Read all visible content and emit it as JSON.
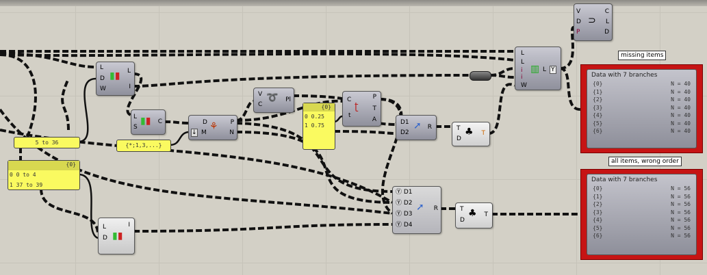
{
  "panels": {
    "range": "5 to 36",
    "pattern": "{*;1,3,...}",
    "list": {
      "path": "{0}",
      "rows": [
        {
          "i": "0",
          "v": "0 to 4"
        },
        {
          "i": "1",
          "v": "37 to 39"
        }
      ]
    },
    "params": {
      "path": "{0}",
      "rows": [
        {
          "i": "0",
          "v": "0.25"
        },
        {
          "i": "1",
          "v": "0.75"
        }
      ]
    }
  },
  "components": {
    "top_right": {
      "in": [
        "V",
        "D",
        "P"
      ],
      "out": [
        "C",
        "L",
        "D"
      ]
    },
    "weave": {
      "in": [
        "L",
        "L",
        "i",
        "i",
        "W"
      ],
      "out": [
        "L"
      ],
      "flag": "Y"
    },
    "dispatch_top": {
      "in": [
        "L",
        "D",
        "W"
      ],
      "out": [
        "L",
        "I"
      ]
    },
    "split": {
      "in": [
        "L",
        "S"
      ],
      "out": [
        "C"
      ]
    },
    "tree": {
      "in": [
        "D",
        "M"
      ],
      "out": [
        "P",
        "N"
      ]
    },
    "perp": {
      "in": [
        "V",
        "C"
      ],
      "out": [
        "Pl"
      ]
    },
    "eval": {
      "in": [
        "C",
        "t"
      ],
      "out": [
        "P",
        "T",
        "A"
      ]
    },
    "merge2": {
      "in": [
        "D1",
        "D2"
      ],
      "out": [
        "R"
      ]
    },
    "shift2": {
      "in": [
        "T",
        "D"
      ],
      "out": [
        "T"
      ]
    },
    "merge4": {
      "in": [
        "D1",
        "D2",
        "D3",
        "D4"
      ],
      "out": [
        "R"
      ]
    },
    "shift4": {
      "in": [
        "T",
        "D"
      ],
      "out": [
        "T"
      ]
    },
    "dispatch_bottom": {
      "in": [
        "L",
        "D"
      ],
      "out": [
        "I"
      ]
    }
  },
  "viewers": [
    {
      "tooltip": "missing items",
      "title": "Data with 7 branches",
      "rows": [
        [
          "{0}",
          "N = 40"
        ],
        [
          "{1}",
          "N = 40"
        ],
        [
          "{2}",
          "N = 40"
        ],
        [
          "{3}",
          "N = 40"
        ],
        [
          "{4}",
          "N = 40"
        ],
        [
          "{5}",
          "N = 40"
        ],
        [
          "{6}",
          "N = 40"
        ]
      ]
    },
    {
      "tooltip": "all items, wrong order",
      "title": "Data with 7 branches",
      "rows": [
        [
          "{0}",
          "N = 56"
        ],
        [
          "{1}",
          "N = 56"
        ],
        [
          "{2}",
          "N = 56"
        ],
        [
          "{3}",
          "N = 56"
        ],
        [
          "{4}",
          "N = 56"
        ],
        [
          "{5}",
          "N = 56"
        ],
        [
          "{6}",
          "N = 56"
        ]
      ]
    }
  ],
  "colors": {
    "panel": "#fafa60",
    "alert": "#c61414",
    "canvas": "#d3d0c6"
  }
}
